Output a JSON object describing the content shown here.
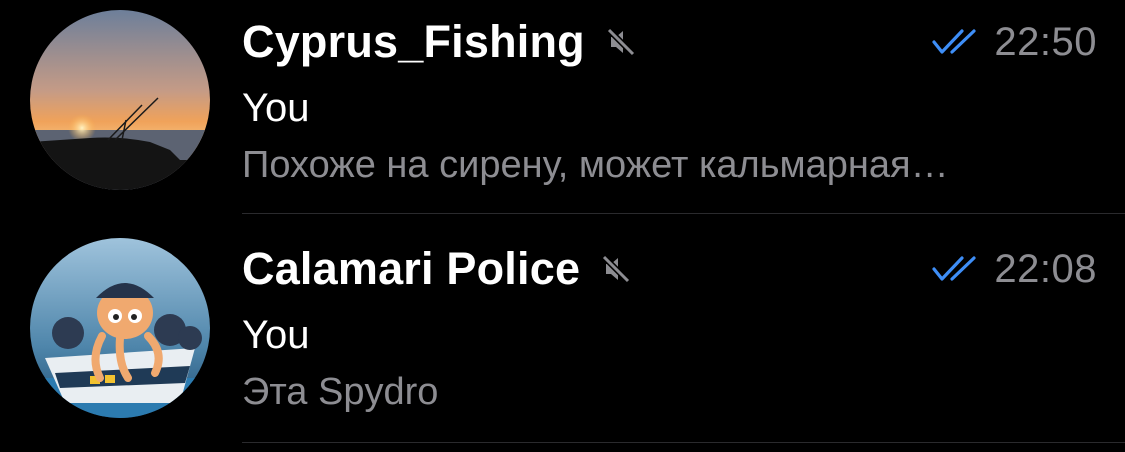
{
  "chats": [
    {
      "title": "Cyprus_Fishing",
      "muted": true,
      "read_status": "double-check",
      "time": "22:50",
      "sender": "You",
      "preview": "Похоже на сирену, может кальмарная…",
      "avatar": "sunset-fishing-rods-photo"
    },
    {
      "title": "Calamari Police",
      "muted": true,
      "read_status": "double-check",
      "time": "22:08",
      "sender": "You",
      "preview": "Эта Spydro",
      "avatar": "cartoon-octopus-police-boat"
    }
  ],
  "colors": {
    "background": "#000000",
    "title": "#ffffff",
    "secondary_text": "#8d8d92",
    "read_check": "#3e8ef7",
    "mute_icon": "#8d8d92",
    "separator": "#2a2a2d"
  }
}
